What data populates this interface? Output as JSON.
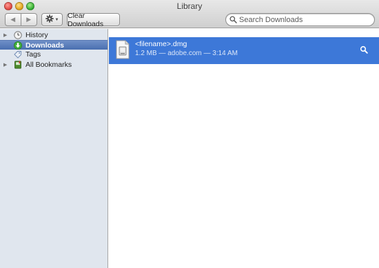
{
  "window": {
    "title": "Library"
  },
  "toolbar": {
    "back_label": "◀",
    "forward_label": "▶",
    "clear_downloads_label": "Clear Downloads"
  },
  "search": {
    "placeholder": "Search Downloads",
    "value": ""
  },
  "sidebar": {
    "items": [
      {
        "label": "History",
        "icon": "clock-icon",
        "expandable": true,
        "selected": false
      },
      {
        "label": "Downloads",
        "icon": "download-arrow-icon",
        "expandable": false,
        "selected": true
      },
      {
        "label": "Tags",
        "icon": "tag-icon",
        "expandable": false,
        "selected": false
      },
      {
        "label": "All Bookmarks",
        "icon": "bookmarks-book-icon",
        "expandable": true,
        "selected": false
      }
    ]
  },
  "downloads": [
    {
      "name": "<filename>.dmg",
      "meta": "1.2 MB — adobe.com — 3:14 AM",
      "icon": "disk-image-file-icon",
      "selected": true
    }
  ],
  "colors": {
    "selection": "#3d78d8",
    "sidebar_bg": "#e0e6ee",
    "sidebar_selected": "#5577b5"
  }
}
